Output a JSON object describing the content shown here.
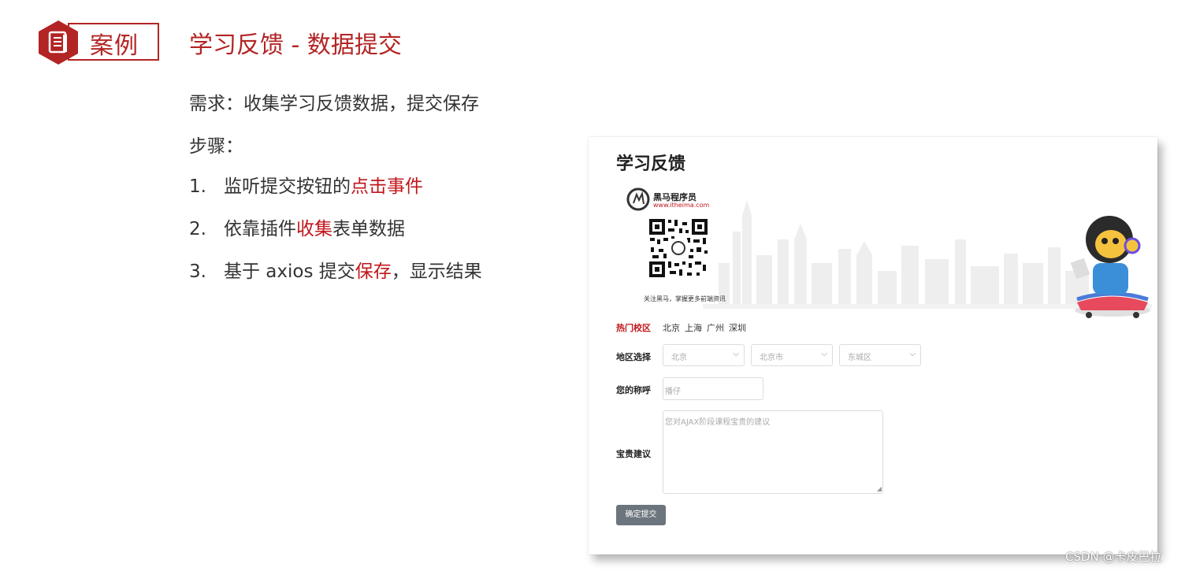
{
  "slide": {
    "badge_label": "案例",
    "title": "学习反馈 - 数据提交",
    "requirement": "需求：收集学习反馈数据，提交保存",
    "steps_label": "步骤：",
    "steps": [
      {
        "num": "1.",
        "pre": "监听提交按钮的",
        "hl": "点击事件",
        "post": ""
      },
      {
        "num": "2.",
        "pre": "依靠插件",
        "hl": "收集",
        "post": "表单数据"
      },
      {
        "num": "3.",
        "pre": "基于 axios 提交",
        "hl": "保存",
        "post": "，显示结果"
      }
    ],
    "accent_color": "#b32424"
  },
  "feedback_form": {
    "title": "学习反馈",
    "brand_name": "黑马程序员",
    "brand_url": "www.itheima.com",
    "qr_caption": "关注黑马，掌握更多前端资讯",
    "hot_campus_label": "热门校区",
    "hot_campuses": [
      "北京",
      "上海",
      "广州",
      "深圳"
    ],
    "region_label": "地区选择",
    "province": "北京",
    "city": "北京市",
    "district": "东城区",
    "name_label": "您的称呼",
    "name_placeholder": "播仔",
    "advice_label": "宝贵建议",
    "advice_placeholder": "您对AJAX阶段课程宝贵的建议",
    "submit_label": "确定提交"
  },
  "watermark": "CSDN @卡皮巴拉"
}
